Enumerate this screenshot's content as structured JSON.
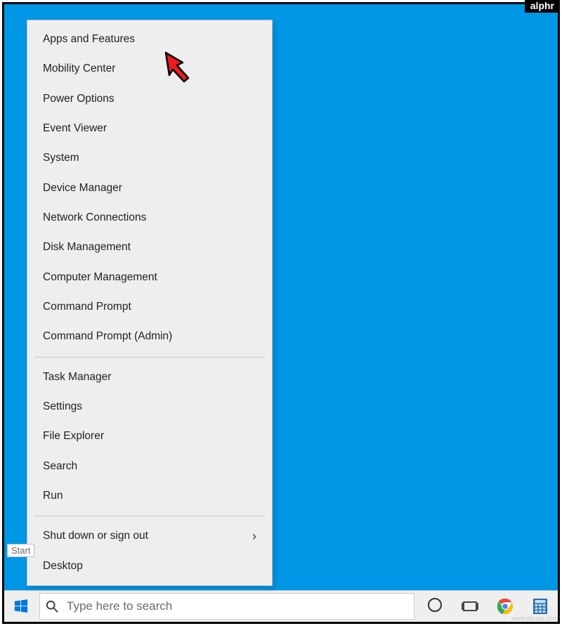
{
  "brand": "alphr",
  "watermark": "www.deuaq.com",
  "cursor_target": "apps-and-features",
  "start_tooltip": "Start",
  "context_menu": {
    "group1": [
      "Apps and Features",
      "Mobility Center",
      "Power Options",
      "Event Viewer",
      "System",
      "Device Manager",
      "Network Connections",
      "Disk Management",
      "Computer Management",
      "Command Prompt",
      "Command Prompt (Admin)"
    ],
    "group2": [
      "Task Manager",
      "Settings",
      "File Explorer",
      "Search",
      "Run"
    ],
    "group3": {
      "shutdown": "Shut down or sign out",
      "desktop": "Desktop"
    }
  },
  "taskbar": {
    "search_placeholder": "Type here to search"
  }
}
